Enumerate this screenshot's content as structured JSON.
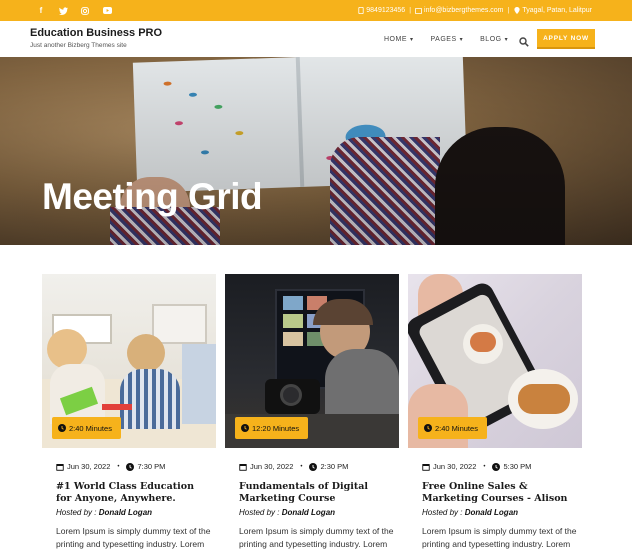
{
  "topbar": {
    "social": [
      "facebook-icon",
      "twitter-icon",
      "instagram-icon",
      "youtube-icon"
    ],
    "phone": "9849123456",
    "email": "info@bizbergthemes.com",
    "address": "Tyagal, Patan, Lalitpur"
  },
  "header": {
    "site_title": "Education Business PRO",
    "tagline": "Just another Bizberg Themes site",
    "nav": [
      {
        "label": "HOME"
      },
      {
        "label": "PAGES"
      },
      {
        "label": "BLOG"
      }
    ],
    "apply_label": "APPLY NOW"
  },
  "hero": {
    "title": "Meeting Grid"
  },
  "cards": [
    {
      "duration": "2:40 Minutes",
      "date": "Jun 30, 2022",
      "time": "7:30 PM",
      "title": "#1 World Class Education for Anyone, Anywhere.",
      "host_prefix": "Hosted by :",
      "host_name": "Donald Logan",
      "desc": "Lorem Ipsum is simply dummy text of the printing and typesetting industry. Lorem Ipsum has been the industry"
    },
    {
      "duration": "12:20 Minutes",
      "date": "Jun 30, 2022",
      "time": "2:30 PM",
      "title": "Fundamentals of Digital Marketing Course",
      "host_prefix": "Hosted by :",
      "host_name": "Donald Logan",
      "desc": "Lorem Ipsum is simply dummy text of the printing and typesetting industry. Lorem Ipsum has been the industry"
    },
    {
      "duration": "2:40 Minutes",
      "date": "Jun 30, 2022",
      "time": "5:30 PM",
      "title": "Free Online Sales & Marketing Courses - Alison",
      "host_prefix": "Hosted by :",
      "host_name": "Donald Logan",
      "desc": "Lorem Ipsum is simply dummy text of the printing and typesetting industry. Lorem Ipsum has been the industry"
    }
  ],
  "colors": {
    "accent": "#f6b21b",
    "text": "#222222"
  }
}
